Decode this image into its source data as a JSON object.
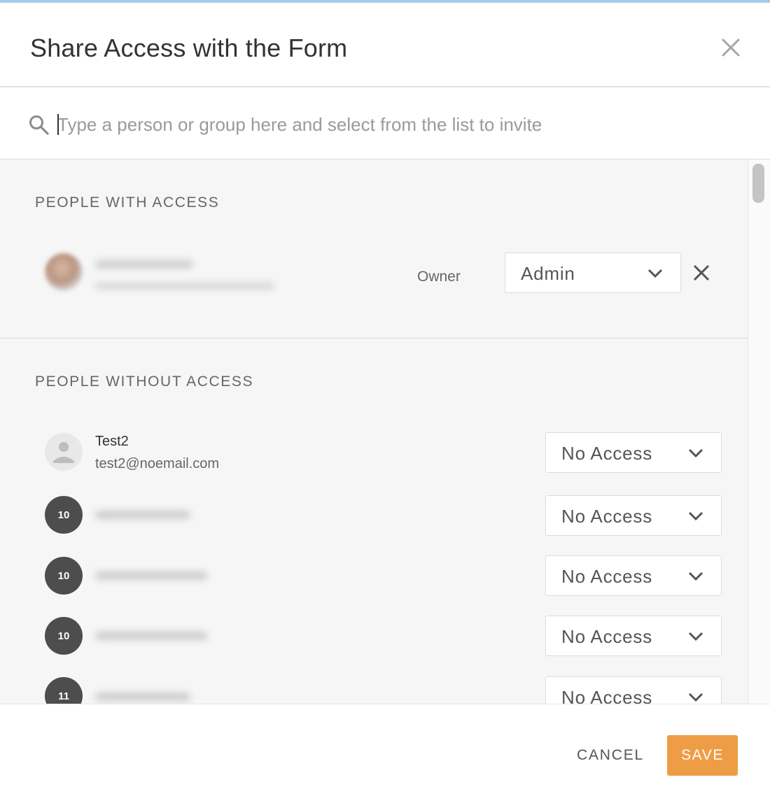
{
  "dialog": {
    "title": "Share Access with the Form"
  },
  "search": {
    "placeholder": "Type a person or group here and select from the list to invite"
  },
  "sections": {
    "with_access_title": "PEOPLE WITH ACCESS",
    "without_access_title": "PEOPLE WITHOUT ACCESS"
  },
  "owner": {
    "role_label": "Owner",
    "permission": "Admin"
  },
  "people_without_access": [
    {
      "name": "Test2",
      "email": "test2@noemail.com",
      "permission": "No Access"
    },
    {
      "avatar_count": "10",
      "permission": "No Access"
    },
    {
      "avatar_count": "10",
      "permission": "No Access"
    },
    {
      "avatar_count": "10",
      "permission": "No Access"
    },
    {
      "avatar_count": "11",
      "permission": "No Access"
    }
  ],
  "footer": {
    "cancel_label": "CANCEL",
    "save_label": "SAVE"
  },
  "colors": {
    "save_button": "#ee9d46",
    "top_strip": "#a9cbe9",
    "content_background": "#f6f6f6",
    "count_avatar": "#4d4d4d"
  },
  "icons": [
    "close-icon",
    "search-icon",
    "chevron-down-icon",
    "remove-icon",
    "person-icon"
  ]
}
